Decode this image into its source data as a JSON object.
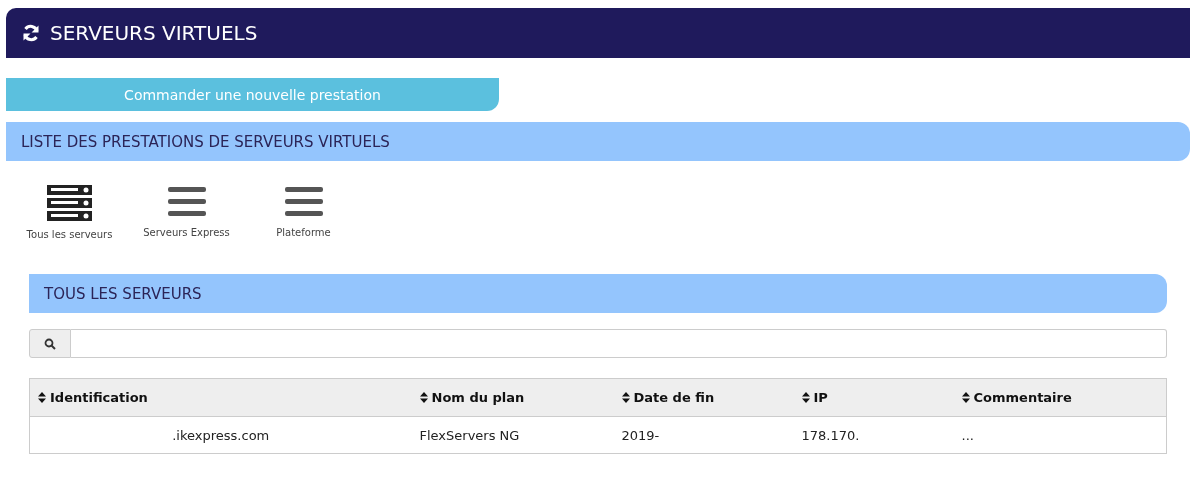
{
  "page_title": "SERVEURS VIRTUELS",
  "order_button": "Commander une nouvelle prestation",
  "list_title": "LISTE DES PRESTATIONS DE SERVEURS VIRTUELS",
  "categories": [
    {
      "label": "Tous les serveurs",
      "selected": true
    },
    {
      "label": "Serveurs Express",
      "selected": false
    },
    {
      "label": "Plateforme",
      "selected": false
    }
  ],
  "section_title": "TOUS LES SERVEURS",
  "table": {
    "columns": [
      "Identification",
      "Nom du plan",
      "Date de fin",
      "IP",
      "Commentaire"
    ],
    "rows": [
      [
        ".ikexpress.com",
        "FlexServers NG",
        "2019-",
        "178.170.",
        "..."
      ]
    ]
  }
}
